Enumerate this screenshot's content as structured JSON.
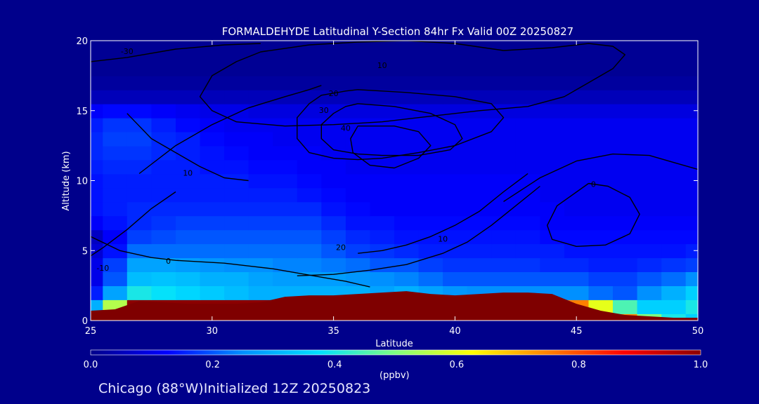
{
  "colors": {
    "background": "#00008b",
    "frame": "#ffffff",
    "contour": "#000000",
    "ground": "#7f0000"
  },
  "footer": "Chicago (88°W)Initialized 12Z 20250823",
  "chart_data": {
    "type": "heatmap",
    "title": "FORMALDEHYDE Latitudinal Y-Section 84hr  Fx Valid 00Z 20250827",
    "xlabel": "Latitude",
    "ylabel": "Altitude (km)",
    "xlim": [
      25,
      50
    ],
    "ylim": [
      0,
      20
    ],
    "x_ticks": [
      "25",
      "30",
      "35",
      "40",
      "45",
      "50"
    ],
    "y_ticks": [
      "0",
      "5",
      "10",
      "15",
      "20"
    ],
    "grid": false,
    "colorbar": {
      "range": [
        0.0,
        1.0
      ],
      "ticks": [
        "0.0",
        "0.2",
        "0.4",
        "0.6",
        "0.8",
        "1.0"
      ],
      "units": "(ppbv)",
      "colors": [
        "#00008b",
        "#0000ff",
        "#0090ff",
        "#00e0ff",
        "#80ff80",
        "#ffff00",
        "#ff8000",
        "#ff0000",
        "#8b0000"
      ]
    },
    "field": {
      "lat": [
        25,
        26,
        27,
        28,
        29,
        30,
        31,
        32,
        33,
        34,
        35,
        36,
        37,
        38,
        39,
        40,
        41,
        42,
        43,
        44,
        45,
        46,
        47,
        48,
        49,
        50
      ],
      "alt": [
        0,
        1,
        2,
        3,
        4,
        5,
        6,
        7,
        8,
        9,
        10,
        11,
        12,
        13,
        14,
        15,
        16,
        17,
        18,
        19,
        20
      ],
      "values": [
        [
          0.95,
          0.98,
          1.0,
          1.0,
          1.0,
          1.0,
          1.0,
          1.0,
          1.0,
          1.0,
          1.0,
          1.0,
          1.0,
          1.0,
          1.0,
          1.0,
          1.0,
          1.0,
          1.0,
          1.0,
          0.95,
          0.85,
          0.75,
          0.5,
          0.4,
          0.35
        ],
        [
          0.3,
          0.55,
          1.0,
          1.0,
          1.0,
          1.0,
          1.0,
          1.0,
          1.0,
          1.0,
          1.0,
          1.0,
          1.0,
          1.0,
          1.0,
          1.0,
          1.0,
          1.0,
          1.0,
          0.95,
          0.75,
          0.6,
          0.45,
          0.35,
          0.35,
          0.4
        ],
        [
          0.15,
          0.28,
          0.4,
          0.38,
          0.36,
          0.34,
          0.32,
          0.3,
          0.3,
          0.3,
          0.3,
          0.3,
          0.28,
          0.3,
          0.28,
          0.26,
          0.25,
          0.25,
          0.25,
          0.25,
          0.25,
          0.22,
          0.2,
          0.25,
          0.3,
          0.35
        ],
        [
          0.1,
          0.2,
          0.32,
          0.33,
          0.32,
          0.3,
          0.3,
          0.28,
          0.27,
          0.27,
          0.27,
          0.26,
          0.25,
          0.24,
          0.22,
          0.2,
          0.2,
          0.2,
          0.2,
          0.2,
          0.2,
          0.18,
          0.18,
          0.2,
          0.22,
          0.25
        ],
        [
          0.1,
          0.18,
          0.28,
          0.28,
          0.27,
          0.26,
          0.25,
          0.25,
          0.24,
          0.24,
          0.23,
          0.22,
          0.2,
          0.2,
          0.18,
          0.17,
          0.17,
          0.17,
          0.17,
          0.16,
          0.16,
          0.15,
          0.15,
          0.16,
          0.17,
          0.18
        ],
        [
          0.08,
          0.14,
          0.22,
          0.22,
          0.22,
          0.22,
          0.22,
          0.22,
          0.22,
          0.22,
          0.2,
          0.18,
          0.17,
          0.16,
          0.15,
          0.15,
          0.15,
          0.15,
          0.15,
          0.15,
          0.14,
          0.14,
          0.14,
          0.14,
          0.14,
          0.15
        ],
        [
          0.06,
          0.12,
          0.18,
          0.19,
          0.2,
          0.2,
          0.2,
          0.2,
          0.2,
          0.2,
          0.18,
          0.16,
          0.15,
          0.14,
          0.14,
          0.14,
          0.14,
          0.14,
          0.14,
          0.13,
          0.13,
          0.13,
          0.13,
          0.13,
          0.13,
          0.13
        ],
        [
          0.12,
          0.14,
          0.16,
          0.17,
          0.18,
          0.18,
          0.18,
          0.18,
          0.18,
          0.18,
          0.16,
          0.14,
          0.14,
          0.13,
          0.13,
          0.13,
          0.13,
          0.13,
          0.13,
          0.12,
          0.12,
          0.12,
          0.12,
          0.12,
          0.12,
          0.12
        ],
        [
          0.14,
          0.15,
          0.16,
          0.16,
          0.16,
          0.16,
          0.16,
          0.16,
          0.16,
          0.16,
          0.14,
          0.13,
          0.12,
          0.12,
          0.12,
          0.12,
          0.12,
          0.12,
          0.12,
          0.12,
          0.11,
          0.11,
          0.11,
          0.11,
          0.11,
          0.11
        ],
        [
          0.14,
          0.15,
          0.15,
          0.15,
          0.15,
          0.15,
          0.15,
          0.15,
          0.15,
          0.14,
          0.13,
          0.12,
          0.12,
          0.12,
          0.12,
          0.12,
          0.12,
          0.12,
          0.12,
          0.11,
          0.11,
          0.11,
          0.11,
          0.11,
          0.11,
          0.11
        ],
        [
          0.14,
          0.15,
          0.15,
          0.15,
          0.15,
          0.15,
          0.15,
          0.14,
          0.14,
          0.13,
          0.12,
          0.12,
          0.12,
          0.12,
          0.12,
          0.12,
          0.12,
          0.12,
          0.12,
          0.11,
          0.11,
          0.11,
          0.11,
          0.11,
          0.11,
          0.11
        ],
        [
          0.15,
          0.16,
          0.16,
          0.15,
          0.15,
          0.14,
          0.14,
          0.13,
          0.13,
          0.12,
          0.12,
          0.11,
          0.11,
          0.11,
          0.11,
          0.11,
          0.11,
          0.11,
          0.11,
          0.11,
          0.11,
          0.11,
          0.11,
          0.11,
          0.11,
          0.11
        ],
        [
          0.16,
          0.17,
          0.17,
          0.16,
          0.15,
          0.14,
          0.13,
          0.12,
          0.12,
          0.12,
          0.11,
          0.11,
          0.11,
          0.11,
          0.11,
          0.11,
          0.11,
          0.11,
          0.11,
          0.11,
          0.11,
          0.11,
          0.11,
          0.11,
          0.11,
          0.11
        ],
        [
          0.16,
          0.18,
          0.18,
          0.16,
          0.15,
          0.13,
          0.12,
          0.12,
          0.11,
          0.11,
          0.11,
          0.11,
          0.11,
          0.11,
          0.11,
          0.11,
          0.11,
          0.11,
          0.11,
          0.11,
          0.11,
          0.11,
          0.11,
          0.11,
          0.11,
          0.11
        ],
        [
          0.15,
          0.17,
          0.17,
          0.15,
          0.13,
          0.12,
          0.11,
          0.11,
          0.11,
          0.11,
          0.11,
          0.11,
          0.11,
          0.11,
          0.11,
          0.11,
          0.11,
          0.11,
          0.11,
          0.11,
          0.11,
          0.11,
          0.11,
          0.11,
          0.11,
          0.11
        ],
        [
          0.12,
          0.13,
          0.13,
          0.12,
          0.11,
          0.1,
          0.1,
          0.09,
          0.09,
          0.09,
          0.09,
          0.09,
          0.09,
          0.09,
          0.09,
          0.09,
          0.09,
          0.09,
          0.09,
          0.09,
          0.09,
          0.09,
          0.09,
          0.09,
          0.09,
          0.09
        ],
        [
          0.05,
          0.05,
          0.05,
          0.05,
          0.05,
          0.05,
          0.05,
          0.05,
          0.05,
          0.05,
          0.05,
          0.05,
          0.05,
          0.05,
          0.05,
          0.05,
          0.05,
          0.05,
          0.05,
          0.05,
          0.05,
          0.05,
          0.05,
          0.05,
          0.05,
          0.05
        ],
        [
          0.02,
          0.02,
          0.02,
          0.02,
          0.02,
          0.02,
          0.02,
          0.02,
          0.02,
          0.02,
          0.02,
          0.02,
          0.02,
          0.02,
          0.02,
          0.02,
          0.02,
          0.02,
          0.02,
          0.02,
          0.02,
          0.02,
          0.02,
          0.02,
          0.02,
          0.02
        ],
        [
          0.01,
          0.01,
          0.01,
          0.01,
          0.01,
          0.01,
          0.01,
          0.01,
          0.01,
          0.01,
          0.01,
          0.01,
          0.01,
          0.01,
          0.01,
          0.01,
          0.01,
          0.01,
          0.01,
          0.01,
          0.01,
          0.01,
          0.01,
          0.01,
          0.01,
          0.01
        ],
        [
          0.01,
          0.01,
          0.01,
          0.01,
          0.01,
          0.01,
          0.01,
          0.01,
          0.01,
          0.01,
          0.01,
          0.01,
          0.01,
          0.01,
          0.01,
          0.01,
          0.01,
          0.01,
          0.01,
          0.01,
          0.01,
          0.01,
          0.01,
          0.01,
          0.01,
          0.01
        ],
        [
          0.01,
          0.01,
          0.01,
          0.01,
          0.01,
          0.01,
          0.01,
          0.01,
          0.01,
          0.01,
          0.01,
          0.01,
          0.01,
          0.01,
          0.01,
          0.01,
          0.01,
          0.01,
          0.01,
          0.01,
          0.01,
          0.01,
          0.01,
          0.01,
          0.01,
          0.01
        ]
      ]
    },
    "terrain": {
      "lat": [
        25,
        26,
        27,
        28,
        29,
        30,
        31,
        32,
        33,
        34,
        35,
        36,
        37,
        38,
        39,
        40,
        41,
        42,
        43,
        44,
        45,
        46,
        47,
        48,
        49,
        50
      ],
      "alt": [
        0.7,
        0.8,
        1.4,
        1.3,
        1.2,
        1.2,
        1.2,
        1.3,
        1.7,
        1.8,
        1.8,
        1.9,
        2.0,
        2.1,
        1.9,
        1.8,
        1.9,
        2.0,
        2.0,
        1.9,
        1.2,
        0.7,
        0.4,
        0.3,
        0.2,
        0.2
      ]
    },
    "contours": [
      {
        "label": "10",
        "lat": [
          42,
          40,
          38,
          36,
          34,
          32,
          31,
          30,
          29.5,
          30,
          31,
          33,
          35,
          37,
          39,
          41,
          43,
          44.5,
          45.5,
          46.5,
          47,
          46.5,
          45.5,
          44,
          42
        ],
        "alt": [
          19.3,
          19.8,
          20.0,
          19.9,
          19.7,
          19.2,
          18.5,
          17.5,
          16.0,
          15.0,
          14.2,
          13.9,
          14.0,
          14.2,
          14.6,
          15.0,
          15.3,
          16.0,
          17.0,
          18.0,
          19.0,
          19.6,
          19.8,
          19.5,
          19.3
        ],
        "label_at": [
          37,
          18.2
        ]
      },
      {
        "label": "20",
        "lat": [
          36,
          38,
          40,
          41.5,
          42,
          41.5,
          40,
          38.5,
          37,
          36,
          35,
          34,
          33.5,
          33.5,
          34,
          34.5,
          35.5,
          36
        ],
        "alt": [
          16.5,
          16.3,
          16.0,
          15.5,
          14.5,
          13.5,
          12.5,
          12.0,
          11.6,
          11.5,
          11.6,
          12.0,
          13.0,
          14.5,
          15.5,
          16.1,
          16.4,
          16.5
        ],
        "label_at": [
          35,
          16.2
        ]
      },
      {
        "label": "30",
        "lat": [
          36,
          37.5,
          39,
          40,
          40.3,
          39.8,
          38.5,
          37,
          36,
          35,
          34.5,
          34.5,
          35,
          35.5,
          36
        ],
        "alt": [
          15.5,
          15.3,
          14.8,
          14.0,
          13.0,
          12.2,
          11.8,
          11.8,
          11.9,
          12.2,
          13.0,
          14.0,
          14.8,
          15.3,
          15.5
        ],
        "label_at": [
          34.6,
          15.0
        ]
      },
      {
        "label": "40",
        "lat": [
          36,
          37.5,
          38.5,
          39,
          38.5,
          37.5,
          36.5,
          35.8,
          35.7,
          36
        ],
        "alt": [
          13.9,
          13.9,
          13.5,
          12.5,
          11.6,
          10.9,
          11.1,
          12.0,
          13.0,
          13.9
        ],
        "label_at": [
          35.5,
          13.7
        ]
      },
      {
        "label": "-10",
        "lat": [
          24.9,
          25.5,
          26.5,
          27.5,
          28.5
        ],
        "alt": [
          4.5,
          5.2,
          6.5,
          8.0,
          9.2
        ],
        "label_at": [
          25.5,
          3.7
        ]
      },
      {
        "label": "0",
        "lat": [
          25,
          26.2,
          27.5,
          28.5,
          29.5,
          30.5,
          31.5,
          32.5,
          33.5,
          34.5,
          35.5,
          36.5
        ],
        "alt": [
          6.0,
          5.0,
          4.5,
          4.3,
          4.2,
          4.1,
          3.9,
          3.7,
          3.4,
          3.1,
          2.8,
          2.4
        ],
        "label_at": [
          28.2,
          4.2
        ]
      },
      {
        "label": "20",
        "lat": [
          36,
          37,
          38,
          39,
          40,
          41,
          42,
          43
        ],
        "alt": [
          4.8,
          5.0,
          5.4,
          6.0,
          6.8,
          7.8,
          9.2,
          10.5
        ],
        "label_at": [
          35.3,
          5.2
        ]
      },
      {
        "label": "10",
        "lat": [
          33.5,
          35,
          36.5,
          38,
          39.5,
          40.5,
          41.5,
          42.5,
          43.5
        ],
        "alt": [
          3.2,
          3.3,
          3.6,
          4.0,
          4.8,
          5.6,
          6.8,
          8.2,
          9.6
        ],
        "label_at": [
          39.5,
          5.8
        ]
      },
      {
        "label": "0",
        "lat": [
          45.5,
          46.3,
          47.2,
          47.6,
          47.2,
          46.2,
          45,
          44,
          43.8,
          44.2,
          45.5
        ],
        "alt": [
          9.8,
          9.6,
          8.8,
          7.6,
          6.2,
          5.4,
          5.3,
          5.8,
          6.8,
          8.2,
          9.8
        ],
        "label_at": [
          45.7,
          9.7
        ]
      },
      {
        "label": "",
        "lat": [
          42,
          43.5,
          45,
          46.5,
          48,
          49,
          50
        ],
        "alt": [
          8.5,
          10.2,
          11.4,
          11.9,
          11.8,
          11.3,
          10.8
        ],
        "label_at": null
      },
      {
        "label": "",
        "lat": [
          27,
          28.5,
          30,
          31.5,
          33,
          34,
          34.5
        ],
        "alt": [
          10.5,
          12.5,
          14.0,
          15.2,
          16.0,
          16.5,
          16.8
        ],
        "label_at": null
      },
      {
        "label": "10",
        "lat": [
          26.5,
          27.5,
          28.5,
          29.5,
          30.5,
          31.5
        ],
        "alt": [
          14.8,
          13.0,
          12.0,
          11.0,
          10.2,
          10.0
        ],
        "label_at": [
          29,
          10.5
        ]
      },
      {
        "label": "-30",
        "lat": [
          25,
          26.5,
          28.5,
          30.5,
          32
        ],
        "alt": [
          18.5,
          18.8,
          19.4,
          19.7,
          19.8
        ],
        "label_at": [
          26.5,
          19.2
        ]
      }
    ]
  }
}
